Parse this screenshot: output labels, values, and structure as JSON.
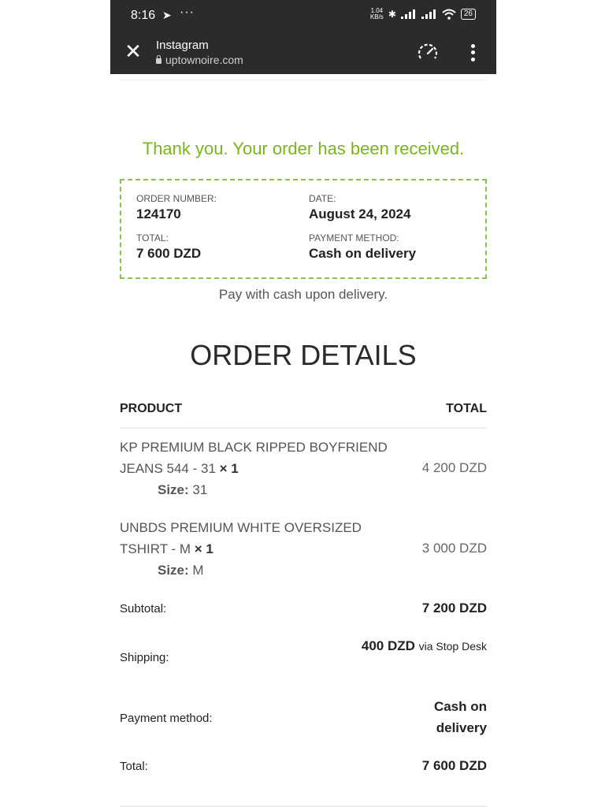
{
  "status_bar": {
    "time": "8:16",
    "net_speed": "1.04\nKB/s",
    "battery": "26"
  },
  "browser": {
    "tab_title": "Instagram",
    "url": "uptownoire.com"
  },
  "order": {
    "thank_you": "Thank you. Your order has been received.",
    "number_label": "ORDER NUMBER:",
    "number": "124170",
    "date_label": "DATE:",
    "date": "August 24, 2024",
    "total_label": "TOTAL:",
    "total": "7 600 DZD",
    "payment_label": "PAYMENT METHOD:",
    "payment": "Cash on delivery",
    "pay_note": "Pay with cash upon delivery."
  },
  "details": {
    "title": "ORDER DETAILS",
    "col_product": "PRODUCT",
    "col_total": "TOTAL",
    "items": [
      {
        "name": "KP PREMIUM BLACK RIPPED BOYFRIEND JEANS 544 - 31",
        "qty": "× 1",
        "size_label": "Size:",
        "size": "31",
        "total": "4 200 DZD"
      },
      {
        "name": "UNBDS PREMIUM WHITE OVERSIZED TSHIRT - M",
        "qty": "× 1",
        "size_label": "Size:",
        "size": "M",
        "total": "3 000 DZD"
      }
    ],
    "subtotal_label": "Subtotal:",
    "subtotal": "7 200 DZD",
    "shipping_label": "Shipping:",
    "shipping": "400 DZD",
    "shipping_via": "via Stop Desk",
    "payment_label": "Payment method:",
    "payment": "Cash on delivery",
    "total_label": "Total:",
    "total": "7 600 DZD"
  }
}
